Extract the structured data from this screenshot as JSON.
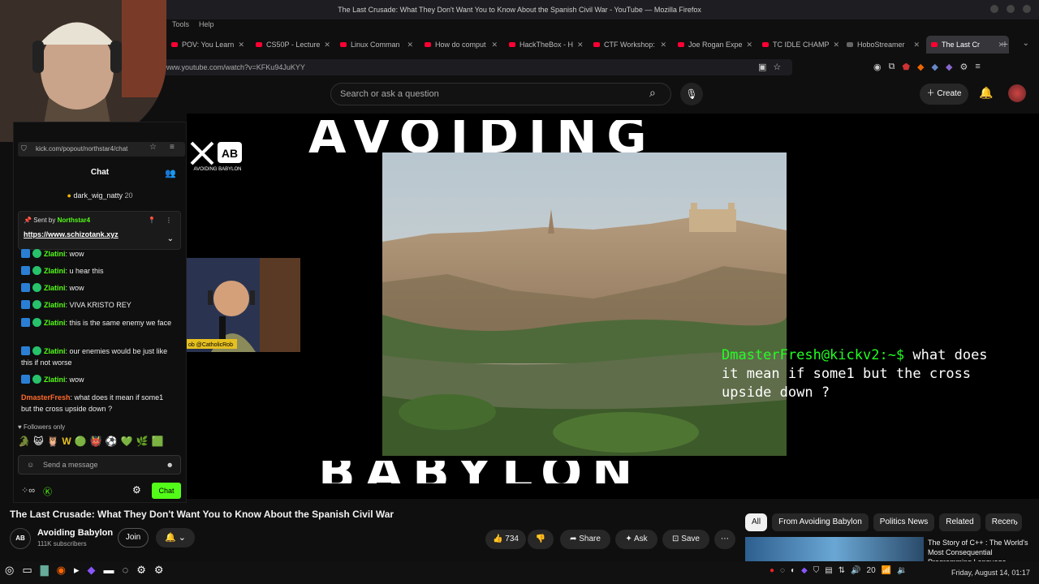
{
  "browser": {
    "window_title": "The Last Crusade: What They Don't Want You to Know About the Spanish Civil War - YouTube — Mozilla Firefox",
    "menu": [
      "Tools",
      "Help"
    ],
    "tabs": [
      {
        "label": "POV: You Learn",
        "active": false
      },
      {
        "label": "CS50P - Lecture",
        "active": false
      },
      {
        "label": "Linux Comman",
        "active": false
      },
      {
        "label": "How do comput",
        "active": false
      },
      {
        "label": "HackTheBox - H",
        "active": false
      },
      {
        "label": "CTF Workshop:",
        "active": false
      },
      {
        "label": "Joe Rogan Expe",
        "active": false
      },
      {
        "label": "TC IDLE CHAMP",
        "active": false
      },
      {
        "label": "HoboStreamer",
        "active": false
      },
      {
        "label": "The Last Cr",
        "active": true
      }
    ],
    "url": "www.youtube.com/watch?v=KFKu94JuKYY"
  },
  "youtube": {
    "search_placeholder": "Search or ask a question",
    "create_label": "Create",
    "video_title": "The Last Crusade: What They Don't Want You to Know About the Spanish Civil War",
    "channel": {
      "name": "Avoiding Babylon",
      "subscribers": "111K subscribers",
      "avatar_text": "AB"
    },
    "join_label": "Join",
    "likes": "734",
    "share_label": "Share",
    "ask_label": "Ask",
    "save_label": "Save",
    "chips": [
      "All",
      "From Avoiding Babylon",
      "Politics News",
      "Related",
      "Recen"
    ],
    "rec_title": "The Story of C++ : The World's Most Consequential Programming Language"
  },
  "video_overlay": {
    "big_top_text": "AVOIDING",
    "big_bottom_text": "BABYLON",
    "logo_text": "AB",
    "logo_caption": "AVOIDING BABYLON",
    "cam_caption": "ob @CatholicRob",
    "terminal_prompt": "DmasterFresh@kickv2:~$",
    "terminal_message": "what does it mean if some1 but the cross upside down ?"
  },
  "kick_chat": {
    "url": "kick.com/popout/northstar4/chat",
    "title": "Chat",
    "gifter": {
      "name": "dark_wig_natty",
      "count": "20"
    },
    "pinned": {
      "sent_by_label": "Sent by",
      "sender": "Northstar4",
      "link": "https://www.schizotank.xyz"
    },
    "messages": [
      {
        "user": "Zlatini",
        "text": "wow"
      },
      {
        "user": "Zlatini",
        "text": "u hear this"
      },
      {
        "user": "Zlatini",
        "text": "wow"
      },
      {
        "user": "Zlatini",
        "text": "VIVA KRISTO REY"
      },
      {
        "user": "Zlatini",
        "text": "this is the same enemy we face"
      },
      {
        "user": "Zlatini",
        "text": "our enemies would be just like this if not worse"
      },
      {
        "user": "Zlatini",
        "text": "wow"
      },
      {
        "user": "DmasterFresh",
        "text": "what does it mean if some1 but the cross upside down ?"
      }
    ],
    "followers_only": "Followers only",
    "input_placeholder": "Send a message",
    "send_label": "Chat"
  },
  "taskbar": {
    "clock": "Friday, August 14, 01:17",
    "volume_level": "20"
  },
  "colors": {
    "kick_green": "#53fc18",
    "youtube_red": "#ff0033",
    "terminal_green": "#22ff22"
  }
}
